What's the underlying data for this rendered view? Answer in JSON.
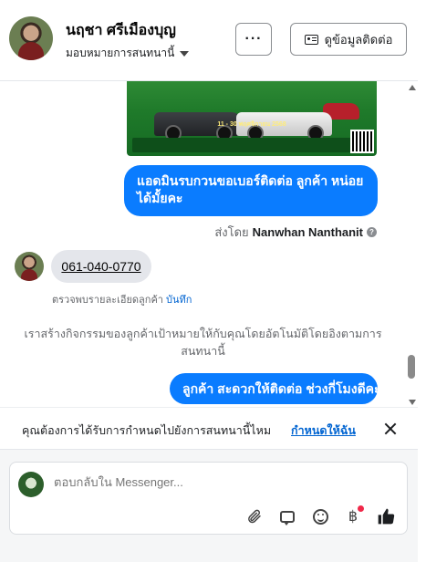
{
  "header": {
    "contact_name": "นฤชา ศรีเมืองบุญ",
    "assign_label": "มอบหมายการสนทนานี้",
    "more_label": "···",
    "contact_details_label": "ดูข้อมูลติดต่อ"
  },
  "chat": {
    "ad_date_text": "11 - 30 พฤศจิกายน 2568",
    "message_out_1": "แอดมินรบกวนขอเบอร์ติดต่อ ลูกค้า หน่อยได้มั้ยคะ",
    "sent_by_prefix": "ส่งโดย",
    "sent_by_name": "Nanwhan Nanthanit",
    "message_in_phone": "061-040-0770",
    "detail_text": "ตรวจพบรายละเอียดลูกค้า",
    "detail_save": "บันทึก",
    "system_text": "เราสร้างกิจกรรมของลูกค้าเป้าหมายให้กับคุณโดยอัตโนมัติโดยอิงตามการสนทนานี้",
    "message_out_2": "ลูกค้า สะดวกให้ติดต่อ ช่วงกี่โมงดีคะ"
  },
  "notice": {
    "text": "คุณต้องการได้รับการกำหนดไปยังการสนทนานี้ไหม",
    "link": "กำหนดให้ฉัน"
  },
  "composer": {
    "placeholder": "ตอบกลับใน Messenger..."
  },
  "icons": {
    "more": "ellipsis-icon",
    "contact_card": "id-card-icon",
    "attach": "paperclip-icon",
    "saved_replies": "chat-bubble-icon",
    "emoji": "smiley-icon",
    "payment": "baht-icon",
    "like": "thumbs-up-icon"
  },
  "colors": {
    "outgoing_bubble": "#0a7cff",
    "incoming_bubble": "#e4e6eb",
    "link": "#0064d1",
    "notification_dot": "#f02849"
  }
}
